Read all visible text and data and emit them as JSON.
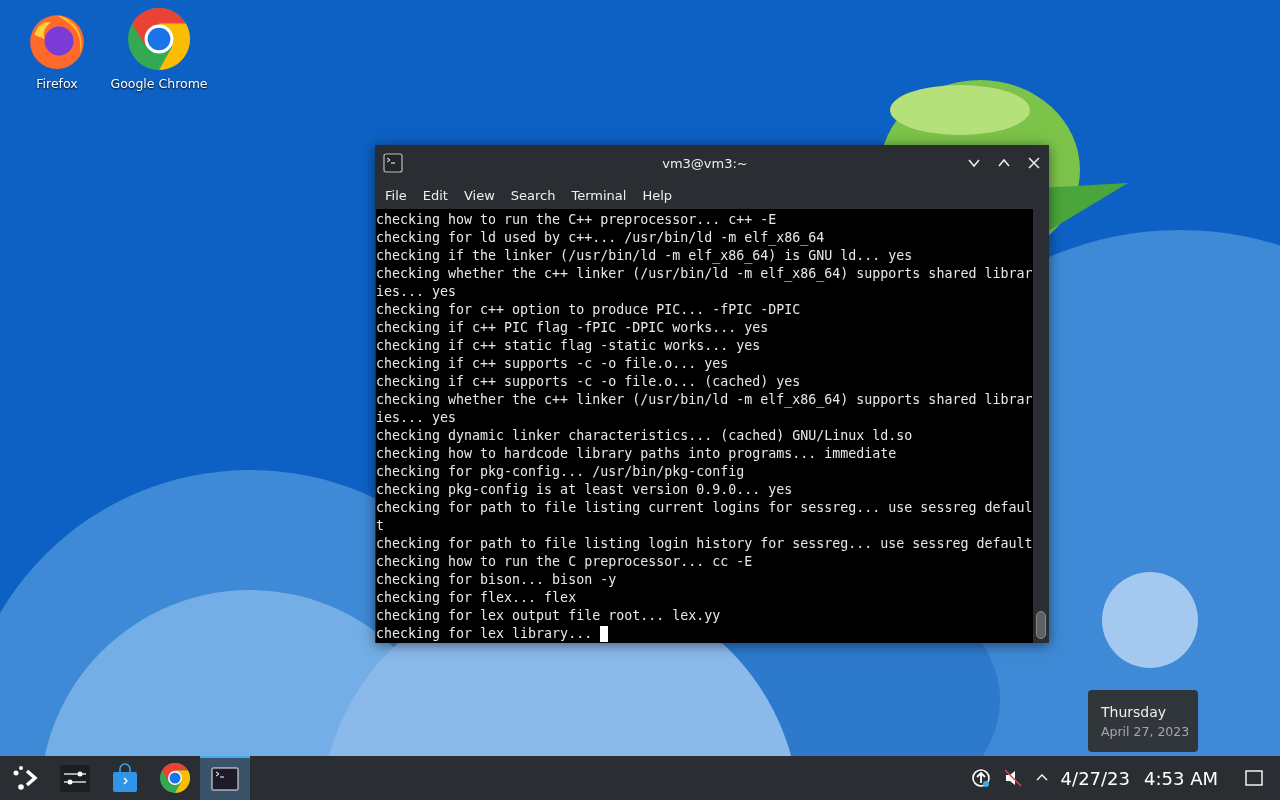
{
  "desktop_icons": [
    {
      "kind": "firefox",
      "label": "Firefox"
    },
    {
      "kind": "chrome",
      "label": "Google Chrome"
    }
  ],
  "window": {
    "title": "vm3@vm3:~",
    "menu": [
      "File",
      "Edit",
      "View",
      "Search",
      "Terminal",
      "Help"
    ],
    "terminal_lines": [
      "checking how to run the C++ preprocessor... c++ -E",
      "checking for ld used by c++... /usr/bin/ld -m elf_x86_64",
      "checking if the linker (/usr/bin/ld -m elf_x86_64) is GNU ld... yes",
      "checking whether the c++ linker (/usr/bin/ld -m elf_x86_64) supports shared librar",
      "ies... yes",
      "checking for c++ option to produce PIC... -fPIC -DPIC",
      "checking if c++ PIC flag -fPIC -DPIC works... yes",
      "checking if c++ static flag -static works... yes",
      "checking if c++ supports -c -o file.o... yes",
      "checking if c++ supports -c -o file.o... (cached) yes",
      "checking whether the c++ linker (/usr/bin/ld -m elf_x86_64) supports shared librar",
      "ies... yes",
      "checking dynamic linker characteristics... (cached) GNU/Linux ld.so",
      "checking how to hardcode library paths into programs... immediate",
      "checking for pkg-config... /usr/bin/pkg-config",
      "checking pkg-config is at least version 0.9.0... yes",
      "checking for path to file listing current logins for sessreg... use sessreg defaul",
      "t",
      "checking for path to file listing login history for sessreg... use sessreg default",
      "checking how to run the C preprocessor... cc -E",
      "checking for bison... bison -y",
      "checking for flex... flex",
      "checking for lex output file root... lex.yy",
      "checking for lex library... "
    ]
  },
  "tooltip": {
    "day": "Thursday",
    "date": "April 27, 2023"
  },
  "taskbar": {
    "apps": [
      {
        "kind": "launcher",
        "selected": false
      },
      {
        "kind": "settings",
        "selected": false
      },
      {
        "kind": "store",
        "selected": false
      },
      {
        "kind": "chrome",
        "selected": false
      },
      {
        "kind": "terminal",
        "selected": true
      }
    ],
    "date": "4/27/23",
    "time": "4:53 AM"
  }
}
